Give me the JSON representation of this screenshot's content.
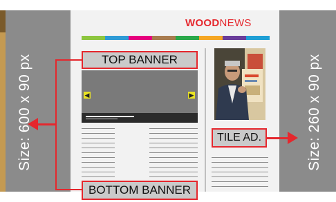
{
  "sizes": {
    "left_label": "Size: 600 x 90 px",
    "right_label": "Size: 260 x 90 px"
  },
  "logo": {
    "bold": "WOOD",
    "thin": "NEWS"
  },
  "banners": {
    "top": "TOP BANNER",
    "bottom": "BOTTOM BANNER",
    "tile": "TILE AD."
  },
  "colors": {
    "accent": "#e5272d",
    "panel": "#8b8b8b",
    "strip": [
      "#8dc63f",
      "#2e9bd6",
      "#e6007e",
      "#a87c4f",
      "#2aa84a",
      "#f5a623",
      "#6a3d9a",
      "#1f9fd5"
    ]
  },
  "icons": {
    "slider_prev": "arrow-left-icon",
    "slider_next": "arrow-right-icon",
    "ad_photo": "man-with-magazine-photo"
  }
}
